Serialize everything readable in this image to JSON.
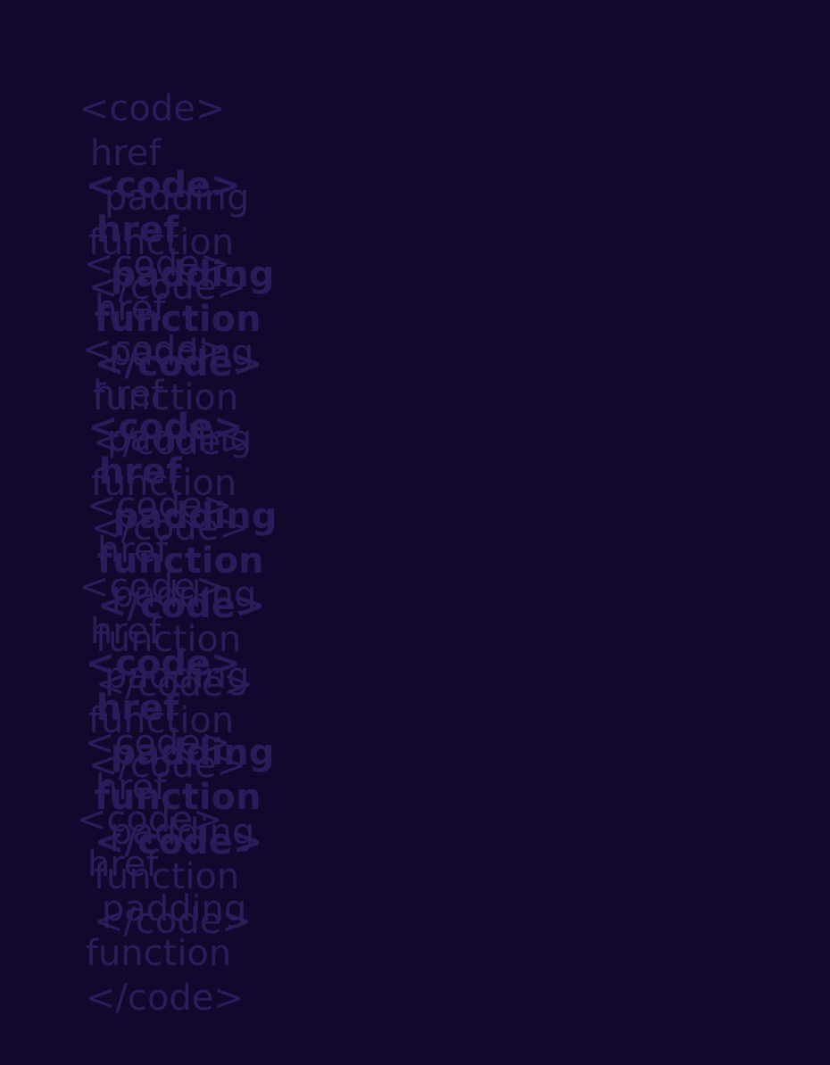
{
  "theme": {
    "background": "#12072c",
    "text_color": "#2b1c5a"
  },
  "lines": [
    {
      "open_tag": "<code>",
      "word1": "href",
      "word2": "padding",
      "word3": "function",
      "close_tag": "</code>",
      "weight": "normal"
    },
    {
      "open_tag": "<code>",
      "word1": "href",
      "word2": "padding",
      "word3": "function",
      "close_tag": "</code>",
      "weight": "bold"
    },
    {
      "open_tag": "<code>",
      "word1": "href",
      "word2": "padding",
      "word3": "function",
      "close_tag": "</code>",
      "weight": "normal"
    },
    {
      "open_tag": "<code>",
      "word1": "href",
      "word2": "padding",
      "word3": "function",
      "close_tag": "</code>",
      "weight": "normal"
    },
    {
      "open_tag": "<code>",
      "word1": "href",
      "word2": "padding",
      "word3": "function",
      "close_tag": "</code>",
      "weight": "bold"
    },
    {
      "open_tag": "<code>",
      "word1": "href",
      "word2": "padding",
      "word3": "function",
      "close_tag": "</code>",
      "weight": "normal"
    },
    {
      "open_tag": "<code>",
      "word1": "href",
      "word2": "padding",
      "word3": "function",
      "close_tag": "</code>",
      "weight": "normal"
    },
    {
      "open_tag": "<code>",
      "word1": "href",
      "word2": "padding",
      "word3": "function",
      "close_tag": "</code>",
      "weight": "bold"
    },
    {
      "open_tag": "<code>",
      "word1": "href",
      "word2": "padding",
      "word3": "function",
      "close_tag": "</code>",
      "weight": "normal"
    },
    {
      "open_tag": "<code>",
      "word1": "href",
      "word2": "padding",
      "word3": "function",
      "close_tag": "</code>",
      "weight": "normal"
    }
  ]
}
